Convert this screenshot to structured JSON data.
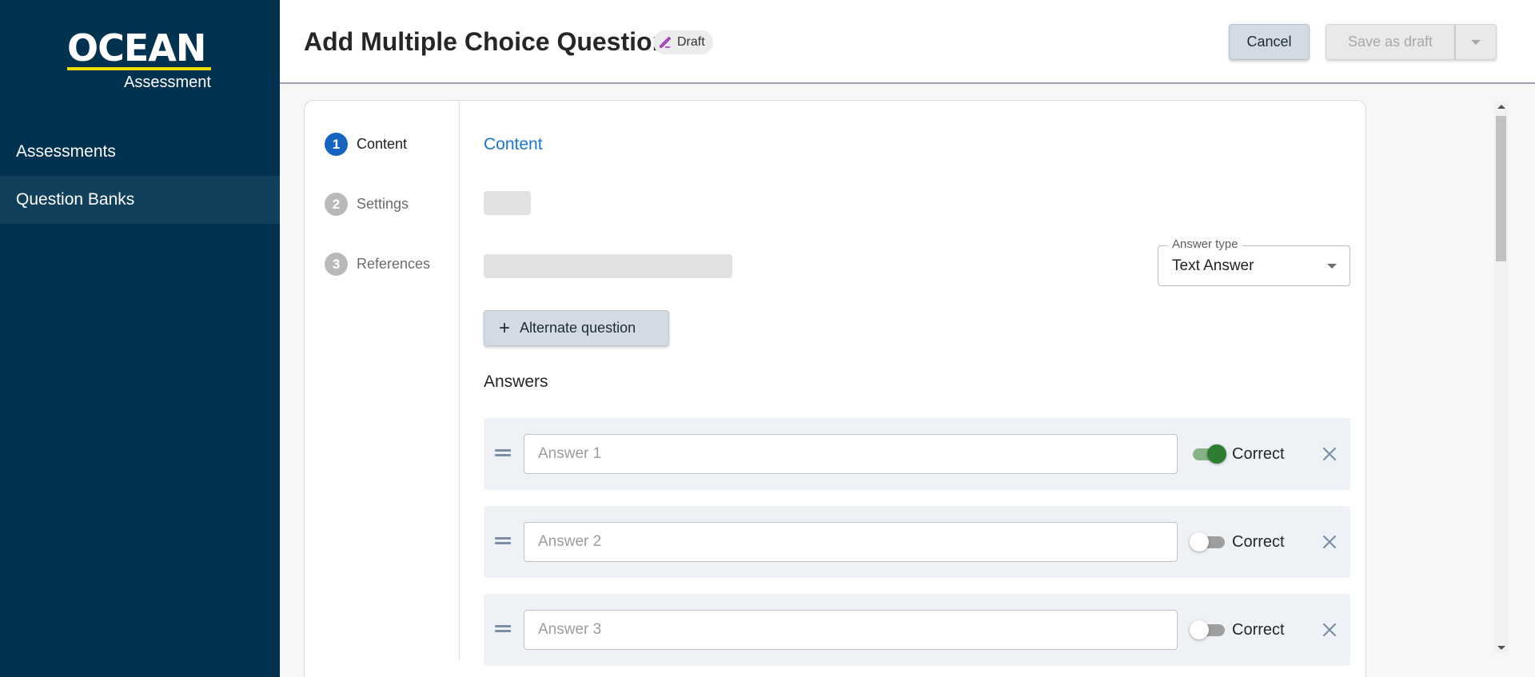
{
  "brand": {
    "name": "OCEAN",
    "sub": "Assessment"
  },
  "sidebar": {
    "items": [
      {
        "label": "Assessments",
        "active": false
      },
      {
        "label": "Question Banks",
        "active": true
      }
    ]
  },
  "header": {
    "title": "Add Multiple Choice Question",
    "badge": "Draft",
    "cancel_label": "Cancel",
    "save_label": "Save as draft"
  },
  "steps": [
    {
      "num": "1",
      "label": "Content",
      "active": true
    },
    {
      "num": "2",
      "label": "Settings",
      "active": false
    },
    {
      "num": "3",
      "label": "References",
      "active": false
    }
  ],
  "content": {
    "section_title": "Content",
    "answer_type": {
      "label": "Answer type",
      "value": "Text Answer"
    },
    "alternate_button": "Alternate question",
    "answers_label": "Answers",
    "answers": [
      {
        "placeholder": "Answer 1",
        "correct": true,
        "correct_label": "Correct"
      },
      {
        "placeholder": "Answer 2",
        "correct": false,
        "correct_label": "Correct"
      },
      {
        "placeholder": "Answer 3",
        "correct": false,
        "correct_label": "Correct"
      }
    ]
  },
  "colors": {
    "sidebar_bg": "#01324f",
    "accent": "#1976d2",
    "toggle_on": "#2e7d32",
    "logo_underline": "#f0e000"
  }
}
